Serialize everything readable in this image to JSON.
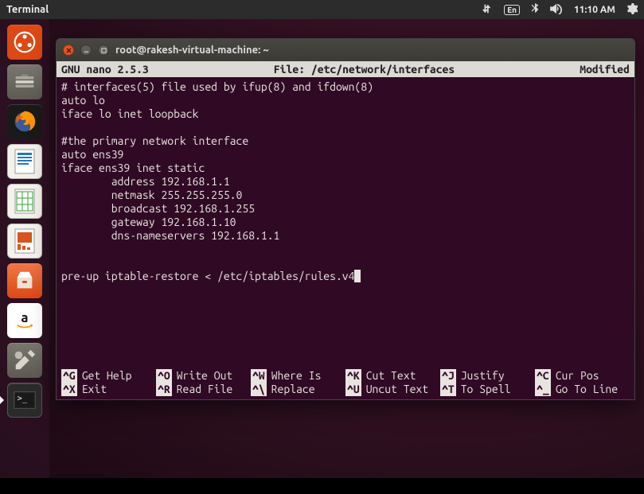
{
  "top_bar": {
    "app_label": "Terminal",
    "lang": "En",
    "time": "11:10 AM"
  },
  "launcher_apps": [
    {
      "name": "dash",
      "bg": "#dd4814"
    },
    {
      "name": "files",
      "bg": "#6b6760"
    },
    {
      "name": "firefox",
      "bg": "#1a1a1a"
    },
    {
      "name": "writer",
      "bg": "#f4f2ea"
    },
    {
      "name": "calc",
      "bg": "#f4f2ea"
    },
    {
      "name": "impress",
      "bg": "#f4f2ea"
    },
    {
      "name": "software",
      "bg": "#dd4814"
    },
    {
      "name": "amazon",
      "bg": "#ffffff"
    },
    {
      "name": "settings",
      "bg": "#6b6760"
    },
    {
      "name": "terminal",
      "bg": "#2b2b2b",
      "active": true
    }
  ],
  "window": {
    "title": "root@rakesh-virtual-machine: ~",
    "nano": {
      "version": "GNU nano 2.5.3",
      "file_label": "File: /etc/network/interfaces",
      "status": "Modified"
    },
    "lines": [
      "# interfaces(5) file used by ifup(8) and ifdown(8)",
      "auto lo",
      "iface lo inet loopback",
      "",
      "#the primary network interface",
      "auto ens39",
      "iface ens39 inet static",
      "        address 192.168.1.1",
      "        netmask 255.255.255.0",
      "        broadcast 192.168.1.255",
      "        gateway 192.168.1.10",
      "        dns-nameservers 192.168.1.1",
      "",
      "",
      "pre-up iptable-restore < /etc/iptables/rules.v4"
    ],
    "shortcuts_row1": [
      {
        "key": "^G",
        "label": "Get Help"
      },
      {
        "key": "^O",
        "label": "Write Out"
      },
      {
        "key": "^W",
        "label": "Where Is"
      },
      {
        "key": "^K",
        "label": "Cut Text"
      },
      {
        "key": "^J",
        "label": "Justify"
      },
      {
        "key": "^C",
        "label": "Cur Pos"
      }
    ],
    "shortcuts_row2": [
      {
        "key": "^X",
        "label": "Exit"
      },
      {
        "key": "^R",
        "label": "Read File"
      },
      {
        "key": "^\\",
        "label": "Replace"
      },
      {
        "key": "^U",
        "label": "Uncut Text"
      },
      {
        "key": "^T",
        "label": "To Spell"
      },
      {
        "key": "^_",
        "label": "Go To Line"
      }
    ]
  }
}
